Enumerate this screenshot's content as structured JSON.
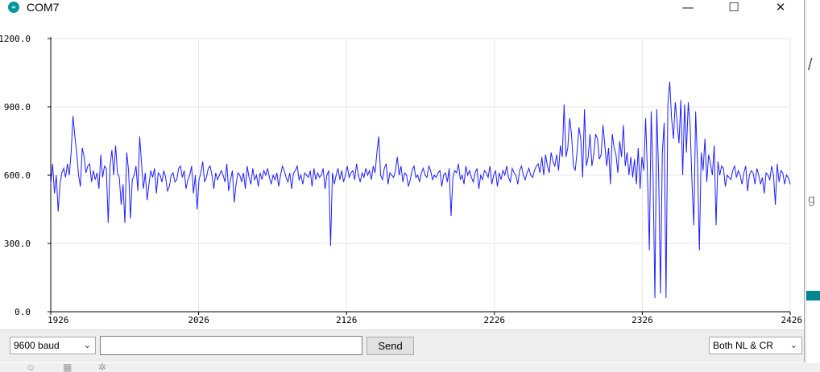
{
  "window": {
    "title": "COM7",
    "icon_name": "arduino-icon",
    "icon_glyph": "∞"
  },
  "window_controls": {
    "minimize": "—",
    "maximize": "☐",
    "close": "✕"
  },
  "controls": {
    "baud_rate": "9600 baud",
    "message_value": "",
    "send_label": "Send",
    "line_ending": "Both NL & CR"
  },
  "colors": {
    "series": "#1f1fff",
    "grid": "#e6e6e6",
    "axis": "#000000",
    "accent": "#00979d"
  },
  "chart_data": {
    "type": "line",
    "title": "",
    "xlabel": "",
    "ylabel": "",
    "xlim": [
      1926,
      2426
    ],
    "ylim": [
      0,
      1200
    ],
    "y_ticks": [
      "0.0",
      "300.0",
      "600.0",
      "900.0",
      "1200.0"
    ],
    "x_ticks": [
      "1926",
      "2026",
      "2126",
      "2226",
      "2326",
      "2426"
    ],
    "grid": true,
    "series": [
      {
        "values": [
          560,
          650,
          520,
          600,
          440,
          560,
          610,
          630,
          590,
          650,
          600,
          700,
          860,
          770,
          700,
          600,
          550,
          720,
          680,
          610,
          640,
          650,
          570,
          620,
          580,
          610,
          540,
          690,
          590,
          640,
          630,
          390,
          640,
          710,
          600,
          730,
          610,
          590,
          470,
          560,
          390,
          700,
          620,
          410,
          580,
          600,
          640,
          530,
          770,
          650,
          540,
          610,
          490,
          560,
          620,
          590,
          630,
          520,
          610,
          600,
          570,
          620,
          590,
          530,
          550,
          600,
          610,
          570,
          580,
          630,
          640,
          590,
          620,
          540,
          580,
          600,
          640,
          520,
          600,
          450,
          580,
          610,
          660,
          570,
          590,
          630,
          640,
          600,
          540,
          610,
          580,
          600,
          620,
          600,
          570,
          650,
          530,
          580,
          620,
          480,
          560,
          610,
          600,
          570,
          610,
          540,
          640,
          590,
          560,
          630,
          580,
          600,
          550,
          610,
          580,
          620,
          600,
          630,
          590,
          560,
          600,
          580,
          610,
          550,
          600,
          640,
          620,
          590,
          570,
          610,
          540,
          610,
          620,
          640,
          580,
          600,
          560,
          610,
          600,
          590,
          620,
          550,
          630,
          580,
          610,
          590,
          600,
          630,
          540,
          600,
          620,
          290,
          610,
          560,
          600,
          630,
          580,
          620,
          570,
          600,
          640,
          590,
          610,
          620,
          580,
          650,
          600,
          570,
          610,
          590,
          630,
          600,
          620,
          580,
          640,
          610,
          700,
          770,
          600,
          580,
          630,
          650,
          560,
          610,
          600,
          590,
          620,
          680,
          600,
          640,
          570,
          610,
          600,
          550,
          580,
          620,
          640,
          590,
          600,
          570,
          610,
          630,
          600,
          590,
          640,
          620,
          580,
          600,
          590,
          610,
          620,
          550,
          600,
          610,
          570,
          630,
          420,
          590,
          620,
          610,
          650,
          580,
          600,
          560,
          640,
          600,
          620,
          590,
          570,
          610,
          630,
          540,
          600,
          580,
          620,
          610,
          590,
          640,
          560,
          600,
          620,
          550,
          610,
          580,
          620,
          600,
          640,
          590,
          570,
          630,
          610,
          600,
          560,
          620,
          640,
          600,
          580,
          610,
          630,
          600,
          590,
          620,
          640,
          650,
          610,
          680,
          600,
          690,
          640,
          610,
          700,
          660,
          640,
          690,
          620,
          730,
          680,
          910,
          680,
          720,
          850,
          780,
          640,
          620,
          700,
          810,
          760,
          590,
          890,
          640,
          680,
          780,
          640,
          690,
          780,
          760,
          670,
          690,
          820,
          730,
          640,
          720,
          560,
          780,
          720,
          690,
          610,
          750,
          680,
          820,
          640,
          700,
          600,
          680,
          590,
          670,
          560,
          720,
          540,
          680,
          620,
          850,
          600,
          270,
          880,
          600,
          60,
          890,
          610,
          80,
          700,
          830,
          60,
          910,
          1010,
          850,
          760,
          920,
          830,
          740,
          930,
          600,
          910,
          700,
          920,
          820,
          570,
          380,
          880,
          650,
          270,
          700,
          620,
          760,
          570,
          690,
          650,
          600,
          730,
          380,
          660,
          600,
          640,
          630,
          550,
          600,
          590,
          580,
          620,
          640,
          590,
          620,
          600,
          560,
          610,
          640,
          530,
          600,
          620,
          610,
          560,
          630,
          600,
          560,
          590,
          520,
          610,
          600,
          580,
          640,
          600,
          470,
          650,
          570,
          620,
          610,
          560,
          600,
          590,
          560
        ]
      }
    ]
  }
}
